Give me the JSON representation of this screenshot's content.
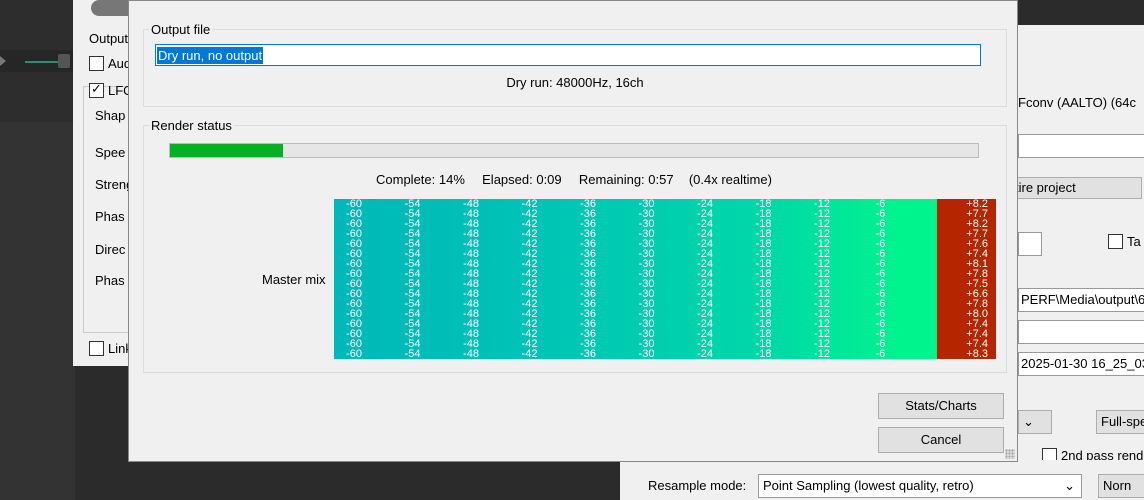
{
  "background": {
    "left_dialog": {
      "output_label": "Output",
      "audio_checkbox": "Aud",
      "lfo_checkbox": "LFO",
      "rows": [
        "Shap",
        "Spee",
        "Streng",
        "Phas",
        "Direc",
        "Phas"
      ],
      "link_checkbox": "Link"
    },
    "right_dialog": {
      "fconv_field": "Fconv (AALTO) (64c",
      "bounds_button": "tire project",
      "ta_checkbox": "Ta",
      "path_field": "PERF\\Media\\output\\6",
      "date_field": "2025-01-30 16_25_03",
      "full_speed_button": "Full-spe",
      "second_pass_checkbox": "2nd pass rend",
      "resample_label": "Resample mode:",
      "resample_value": "Point Sampling (lowest quality, retro)",
      "normal_button": "Norn"
    }
  },
  "dialog": {
    "output_group": {
      "title": "Output file",
      "field_value": "Dry run, no output",
      "info": "Dry run: 48000Hz, 16ch"
    },
    "render_group": {
      "title": "Render status",
      "progress_percent": 14,
      "progress_color": "#06b025",
      "complete_text": "Complete: 14%",
      "elapsed_text": "Elapsed: 0:09",
      "remaining_text": "Remaining: 0:57",
      "realtime_text": "(0.4x realtime)",
      "meter_label": "Master mix",
      "meter_scale": [
        "-60",
        "-54",
        "-48",
        "-42",
        "-36",
        "-30",
        "-24",
        "-18",
        "-12",
        "-6"
      ],
      "channel_peaks": [
        "+8.2",
        "+7.7",
        "+8.2",
        "+7.7",
        "+7.6",
        "+7.4",
        "+8.1",
        "+7.8",
        "+7.5",
        "+6.6",
        "+7.8",
        "+8.0",
        "+7.4",
        "+7.4",
        "+7.4",
        "+8.3"
      ],
      "clip_color": "#b52500"
    },
    "buttons": {
      "stats": "Stats/Charts",
      "cancel": "Cancel"
    }
  }
}
